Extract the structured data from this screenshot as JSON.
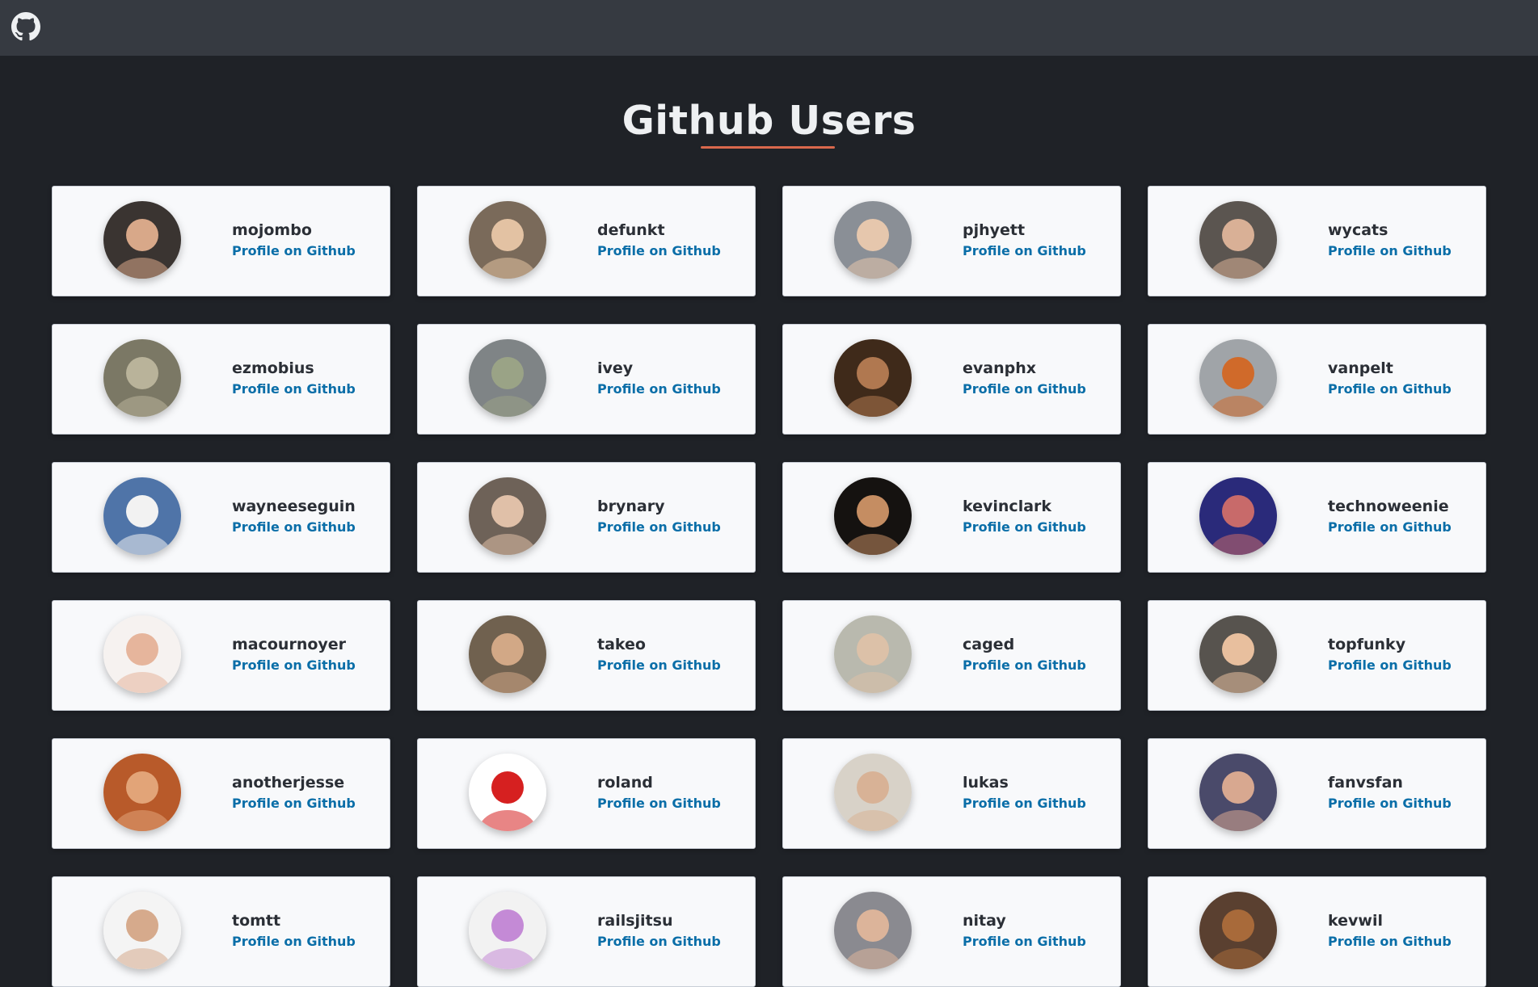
{
  "header": {
    "logo_icon": "github-icon"
  },
  "page": {
    "title": "Github Users",
    "accent_color": "#d9684c"
  },
  "users": [
    {
      "login": "mojombo",
      "link_label": "Profile on Github",
      "avatar_bg": "#3a3431",
      "avatar_fg": "#d8a889"
    },
    {
      "login": "defunkt",
      "link_label": "Profile on Github",
      "avatar_bg": "#7a6a5a",
      "avatar_fg": "#e3c2a3"
    },
    {
      "login": "pjhyett",
      "link_label": "Profile on Github",
      "avatar_bg": "#8a8f96",
      "avatar_fg": "#e6c7ad"
    },
    {
      "login": "wycats",
      "link_label": "Profile on Github",
      "avatar_bg": "#5b5550",
      "avatar_fg": "#d9b096"
    },
    {
      "login": "ezmobius",
      "link_label": "Profile on Github",
      "avatar_bg": "#7b7865",
      "avatar_fg": "#b9b39a"
    },
    {
      "login": "ivey",
      "link_label": "Profile on Github",
      "avatar_bg": "#7f8486",
      "avatar_fg": "#9aa386"
    },
    {
      "login": "evanphx",
      "link_label": "Profile on Github",
      "avatar_bg": "#3f2a1a",
      "avatar_fg": "#b07850"
    },
    {
      "login": "vanpelt",
      "link_label": "Profile on Github",
      "avatar_bg": "#a0a4a8",
      "avatar_fg": "#d06a2a"
    },
    {
      "login": "wayneeseguin",
      "link_label": "Profile on Github",
      "avatar_bg": "#4f74a8",
      "avatar_fg": "#f2f2f2"
    },
    {
      "login": "brynary",
      "link_label": "Profile on Github",
      "avatar_bg": "#6e6258",
      "avatar_fg": "#e0c0a8"
    },
    {
      "login": "kevinclark",
      "link_label": "Profile on Github",
      "avatar_bg": "#151210",
      "avatar_fg": "#c58d62"
    },
    {
      "login": "technoweenie",
      "link_label": "Profile on Github",
      "avatar_bg": "#2a2a7a",
      "avatar_fg": "#c86a6a"
    },
    {
      "login": "macournoyer",
      "link_label": "Profile on Github",
      "avatar_bg": "#f6f2f0",
      "avatar_fg": "#e6b59c"
    },
    {
      "login": "takeo",
      "link_label": "Profile on Github",
      "avatar_bg": "#70614f",
      "avatar_fg": "#d2a886"
    },
    {
      "login": "caged",
      "link_label": "Profile on Github",
      "avatar_bg": "#b9b9ae",
      "avatar_fg": "#dcc1a8"
    },
    {
      "login": "topfunky",
      "link_label": "Profile on Github",
      "avatar_bg": "#57534e",
      "avatar_fg": "#e8bf9e"
    },
    {
      "login": "anotherjesse",
      "link_label": "Profile on Github",
      "avatar_bg": "#b85a2a",
      "avatar_fg": "#e2a478"
    },
    {
      "login": "roland",
      "link_label": "Profile on Github",
      "avatar_bg": "#ffffff",
      "avatar_fg": "#d62020"
    },
    {
      "login": "lukas",
      "link_label": "Profile on Github",
      "avatar_bg": "#d8d2c8",
      "avatar_fg": "#d8b296"
    },
    {
      "login": "fanvsfan",
      "link_label": "Profile on Github",
      "avatar_bg": "#4a4a6a",
      "avatar_fg": "#d8a890"
    },
    {
      "login": "tomtt",
      "link_label": "Profile on Github",
      "avatar_bg": "#f4f4f4",
      "avatar_fg": "#d6aa8c"
    },
    {
      "login": "railsjitsu",
      "link_label": "Profile on Github",
      "avatar_bg": "#f2f2f2",
      "avatar_fg": "#c48ad6"
    },
    {
      "login": "nitay",
      "link_label": "Profile on Github",
      "avatar_bg": "#8a8a90",
      "avatar_fg": "#dcb49a"
    },
    {
      "login": "kevwil",
      "link_label": "Profile on Github",
      "avatar_bg": "#5a4030",
      "avatar_fg": "#a86a3a"
    }
  ]
}
